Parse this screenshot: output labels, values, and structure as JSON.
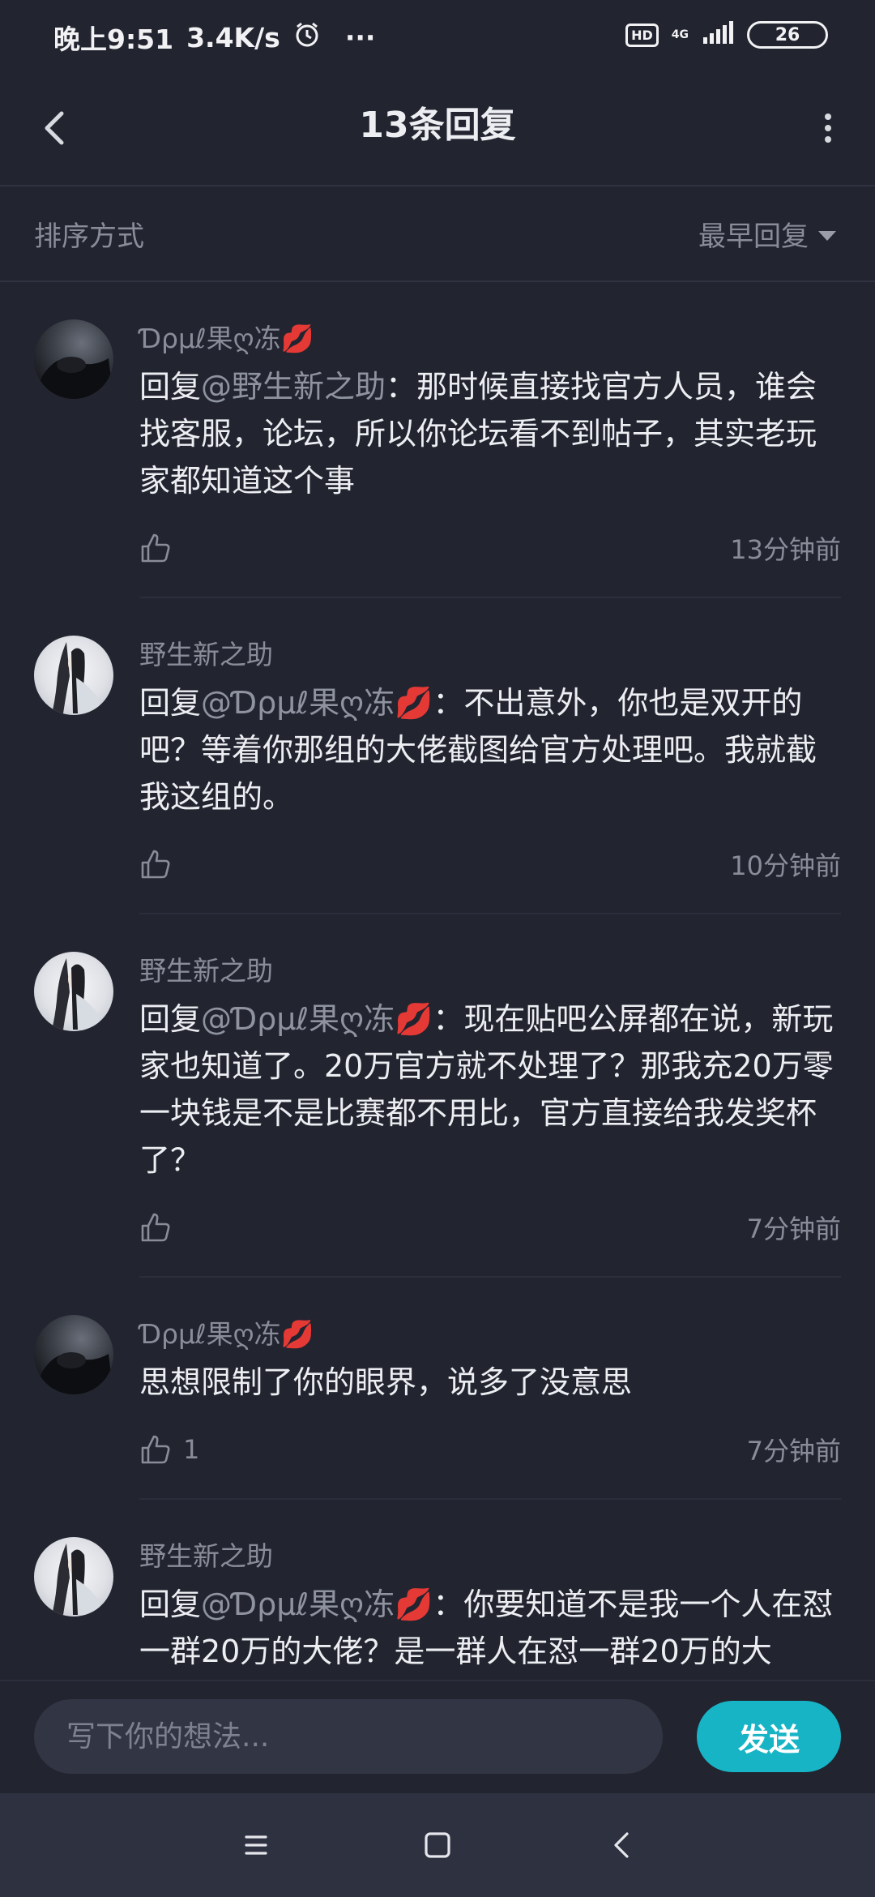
{
  "status_bar": {
    "time": "晚上9:51",
    "speed": "3.4K/s",
    "more": "···",
    "hd": "HD",
    "network": "4G",
    "battery": "26"
  },
  "header": {
    "title": "13条回复"
  },
  "sort": {
    "label": "排序方式",
    "value": "最早回复"
  },
  "comments": [
    {
      "user": "Ɗρµℓ果ღ冻💋",
      "prefix": "回复",
      "mention": "@野生新之助",
      "text": "：那时候直接找官方人员，谁会找客服，论坛，所以你论坛看不到帖子，其实老玩家都知道这个事",
      "likes": "",
      "time": "13分钟前"
    },
    {
      "user": "野生新之助",
      "prefix": "回复",
      "mention": "@Ɗρµℓ果ღ冻💋",
      "text": "：不出意外，你也是双开的吧？等着你那组的大佬截图给官方处理吧。我就截我这组的。",
      "likes": "",
      "time": "10分钟前"
    },
    {
      "user": "野生新之助",
      "prefix": "回复",
      "mention": "@Ɗρµℓ果ღ冻💋",
      "text": "：现在贴吧公屏都在说，新玩家也知道了。20万官方就不处理了？那我充20万零一块钱是不是比赛都不用比，官方直接给我发奖杯了？",
      "likes": "",
      "time": "7分钟前"
    },
    {
      "user": "Ɗρµℓ果ღ冻💋",
      "prefix": "",
      "mention": "",
      "text": "思想限制了你的眼界，说多了没意思",
      "likes": "1",
      "time": "7分钟前"
    },
    {
      "user": "野生新之助",
      "prefix": "回复",
      "mention": "@Ɗρµℓ果ღ冻💋",
      "text": "：你要知道不是我一个人在怼一群20万的大佬？是一群人在怼一群20万的大",
      "likes": "",
      "time": ""
    }
  ],
  "input": {
    "placeholder": "写下你的想法..."
  },
  "send_label": "发送",
  "colors": {
    "background": "#222430",
    "accent": "#17b4c6",
    "muted_text": "#8a8d99"
  }
}
